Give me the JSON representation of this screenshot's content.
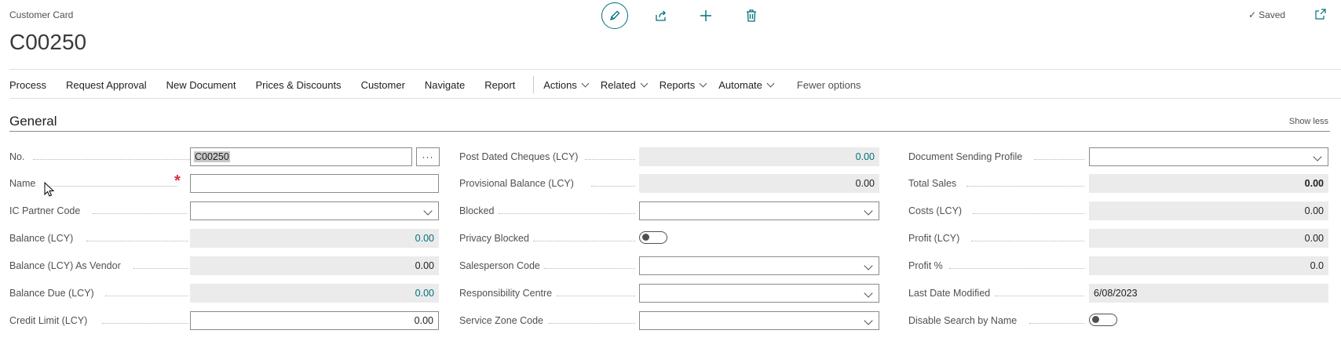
{
  "header": {
    "caption": "Customer Card",
    "title": "C00250",
    "saved_label": "Saved"
  },
  "toolbar_icons": [
    "edit-pencil-icon",
    "share-icon",
    "add-icon",
    "delete-icon",
    "open-new-window-icon"
  ],
  "menu": {
    "items": [
      "Process",
      "Request Approval",
      "New Document",
      "Prices & Discounts",
      "Customer",
      "Navigate",
      "Report"
    ],
    "dropdowns": [
      "Actions",
      "Related",
      "Reports",
      "Automate"
    ],
    "fewer_options": "Fewer options"
  },
  "section": {
    "title": "General",
    "toggle_label": "Show less"
  },
  "col1": {
    "no": {
      "label": "No.",
      "value": "C00250"
    },
    "name": {
      "label": "Name",
      "value": ""
    },
    "ic_partner": {
      "label": "IC Partner Code",
      "value": ""
    },
    "balance": {
      "label": "Balance (LCY)",
      "value": "0.00"
    },
    "balance_vendor": {
      "label": "Balance (LCY) As Vendor",
      "value": "0.00"
    },
    "balance_due": {
      "label": "Balance Due (LCY)",
      "value": "0.00"
    },
    "credit_limit": {
      "label": "Credit Limit (LCY)",
      "value": "0.00"
    }
  },
  "col2": {
    "post_dated": {
      "label": "Post Dated Cheques (LCY)",
      "value": "0.00"
    },
    "provisional": {
      "label": "Provisional Balance (LCY)",
      "value": "0.00"
    },
    "blocked": {
      "label": "Blocked",
      "value": ""
    },
    "privacy_blocked": {
      "label": "Privacy Blocked",
      "value": "off"
    },
    "salesperson": {
      "label": "Salesperson Code",
      "value": ""
    },
    "responsibility": {
      "label": "Responsibility Centre",
      "value": ""
    },
    "service_zone": {
      "label": "Service Zone Code",
      "value": ""
    }
  },
  "col3": {
    "doc_profile": {
      "label": "Document Sending Profile",
      "value": ""
    },
    "total_sales": {
      "label": "Total Sales",
      "value": "0.00"
    },
    "costs": {
      "label": "Costs (LCY)",
      "value": "0.00"
    },
    "profit": {
      "label": "Profit (LCY)",
      "value": "0.00"
    },
    "profit_pct": {
      "label": "Profit %",
      "value": "0.0"
    },
    "last_modified": {
      "label": "Last Date Modified",
      "value": "6/08/2023"
    },
    "disable_search": {
      "label": "Disable Search by Name",
      "value": "off"
    }
  },
  "colors": {
    "accent": "#00707e",
    "required": "#d13438",
    "readonly_bg": "#ebebeb"
  }
}
